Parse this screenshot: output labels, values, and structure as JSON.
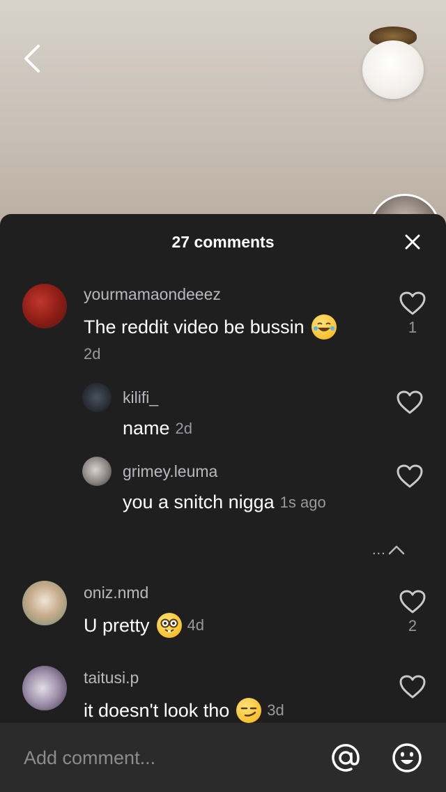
{
  "panel": {
    "title": "27 comments"
  },
  "comments": [
    {
      "username": "yourmamaondeeez",
      "text": "The reddit video be bussin",
      "emoji": "laughing-tears-emoji",
      "time": "2d",
      "likes": "1"
    },
    {
      "username": "kilifi_",
      "text": "name",
      "time": "2d"
    },
    {
      "username": "grimey.leuma",
      "text": "you a snitch nigga",
      "time": "1s ago"
    },
    {
      "username": "oniz.nmd",
      "text": "U pretty",
      "emoji": "nerd-face-emoji",
      "time": "4d",
      "likes": "2"
    },
    {
      "username": "taitusi.p",
      "text": "it doesn't look tho",
      "emoji": "smirk-emoji",
      "time": "3d"
    }
  ],
  "replies_toggle": {
    "dots": "..."
  },
  "composer": {
    "placeholder": "Add comment..."
  },
  "icons": {
    "back": "chevron-left-icon",
    "close": "close-icon",
    "like": "heart-outline-icon",
    "mention": "at-sign-icon",
    "emoji": "smiley-icon",
    "collapse": "chevron-up-icon"
  },
  "colors": {
    "panel_bg": "#1f1f1f",
    "composer_bg": "#2b2b2b",
    "text_primary": "#ffffff",
    "text_secondary": "#b9b9bd"
  }
}
